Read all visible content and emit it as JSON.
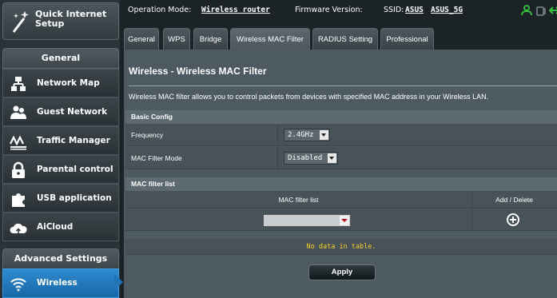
{
  "topbar": {
    "operation_mode_label": "Operation Mode:",
    "operation_mode_value": "Wireless router",
    "firmware_label": "Firmware Version:",
    "ssid_label": "SSID:",
    "ssid_1": "ASUS",
    "ssid_2": "ASUS_5G"
  },
  "sidebar": {
    "quick_setup": "Quick Internet Setup",
    "general_header": "General",
    "items": [
      {
        "label": "Network Map",
        "icon": "network-map-icon"
      },
      {
        "label": "Guest Network",
        "icon": "guest-network-icon"
      },
      {
        "label": "Traffic Manager",
        "icon": "traffic-manager-icon"
      },
      {
        "label": "Parental control",
        "icon": "lock-icon"
      },
      {
        "label": "USB application",
        "icon": "puzzle-icon"
      },
      {
        "label": "AiCloud",
        "icon": "cloud-icon"
      }
    ],
    "advanced_header": "Advanced Settings",
    "active_item": {
      "label": "Wireless",
      "icon": "wifi-icon"
    }
  },
  "tabs": [
    {
      "label": "General"
    },
    {
      "label": "WPS"
    },
    {
      "label": "Bridge"
    },
    {
      "label": "Wireless MAC Filter"
    },
    {
      "label": "RADIUS Setting"
    },
    {
      "label": "Professional"
    }
  ],
  "main": {
    "title": "Wireless - Wireless MAC Filter",
    "description": "Wireless MAC filter allows you to control packets from devices with specified MAC address in your Wireless LAN.",
    "basic_config": {
      "header": "Basic Config",
      "frequency_label": "Frequency",
      "frequency_value": "2.4GHz",
      "mode_label": "MAC Filter Mode",
      "mode_value": "Disabled"
    },
    "mac_list": {
      "header": "MAC filter list",
      "col_list": "MAC filter list",
      "col_action": "Add / Delete",
      "empty_text": "No data in table."
    },
    "apply_label": "Apply"
  },
  "colors": {
    "accent_blue": "#1f75b9",
    "no_data_yellow": "#f6cc2a",
    "status_green": "#35c43b"
  }
}
